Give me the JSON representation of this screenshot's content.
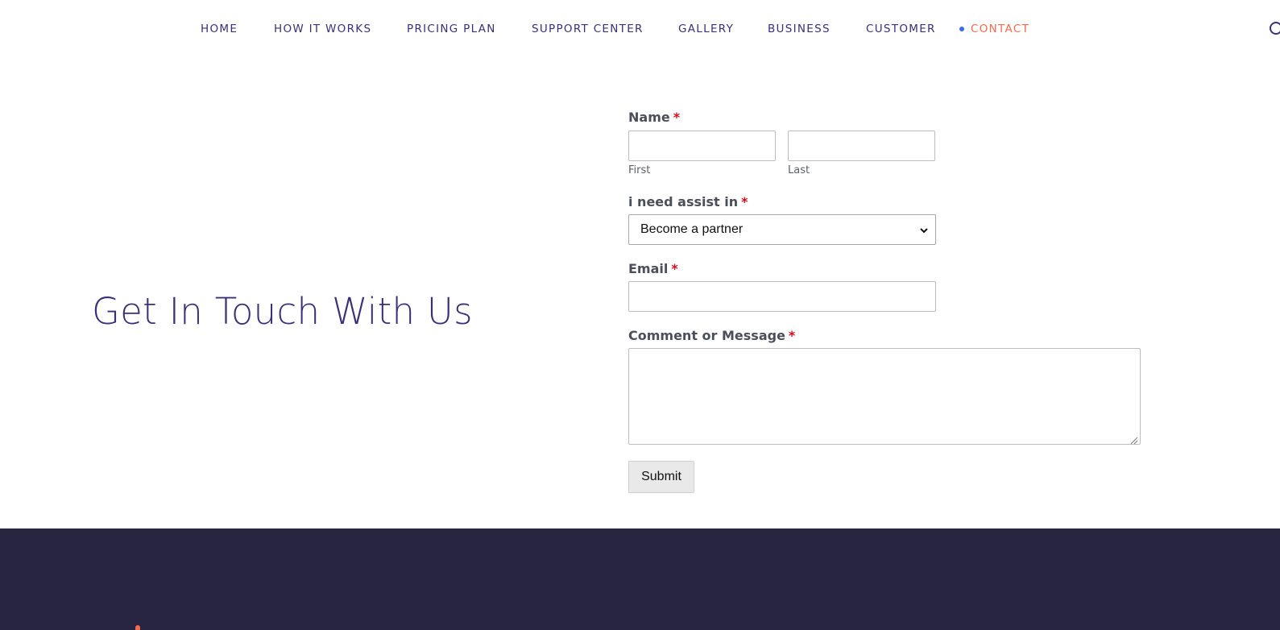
{
  "nav": {
    "items": [
      {
        "label": "HOME"
      },
      {
        "label": "HOW IT WORKS"
      },
      {
        "label": "PRICING PLAN"
      },
      {
        "label": "SUPPORT CENTER"
      },
      {
        "label": "GALLERY"
      },
      {
        "label": "BUSINESS"
      },
      {
        "label": "CUSTOMER"
      },
      {
        "label": "CONTACT",
        "active": true
      }
    ],
    "search_icon": "search-icon"
  },
  "hero": {
    "title": "Get In Touch With Us"
  },
  "form": {
    "name": {
      "label": "Name",
      "required_mark": "*",
      "first_value": "",
      "last_value": "",
      "first_sublabel": "First",
      "last_sublabel": "Last"
    },
    "assist": {
      "label": "i need assist in",
      "required_mark": "*",
      "selected": "Become a partner"
    },
    "email": {
      "label": "Email",
      "required_mark": "*",
      "value": ""
    },
    "message": {
      "label": "Comment or Message",
      "required_mark": "*",
      "value": ""
    },
    "submit_label": "Submit"
  },
  "colors": {
    "nav_text": "#3b2f78",
    "nav_active": "#f26b50",
    "nav_dot": "#3b6cf0",
    "required": "#d60b1d",
    "footer_bg": "#282541"
  }
}
